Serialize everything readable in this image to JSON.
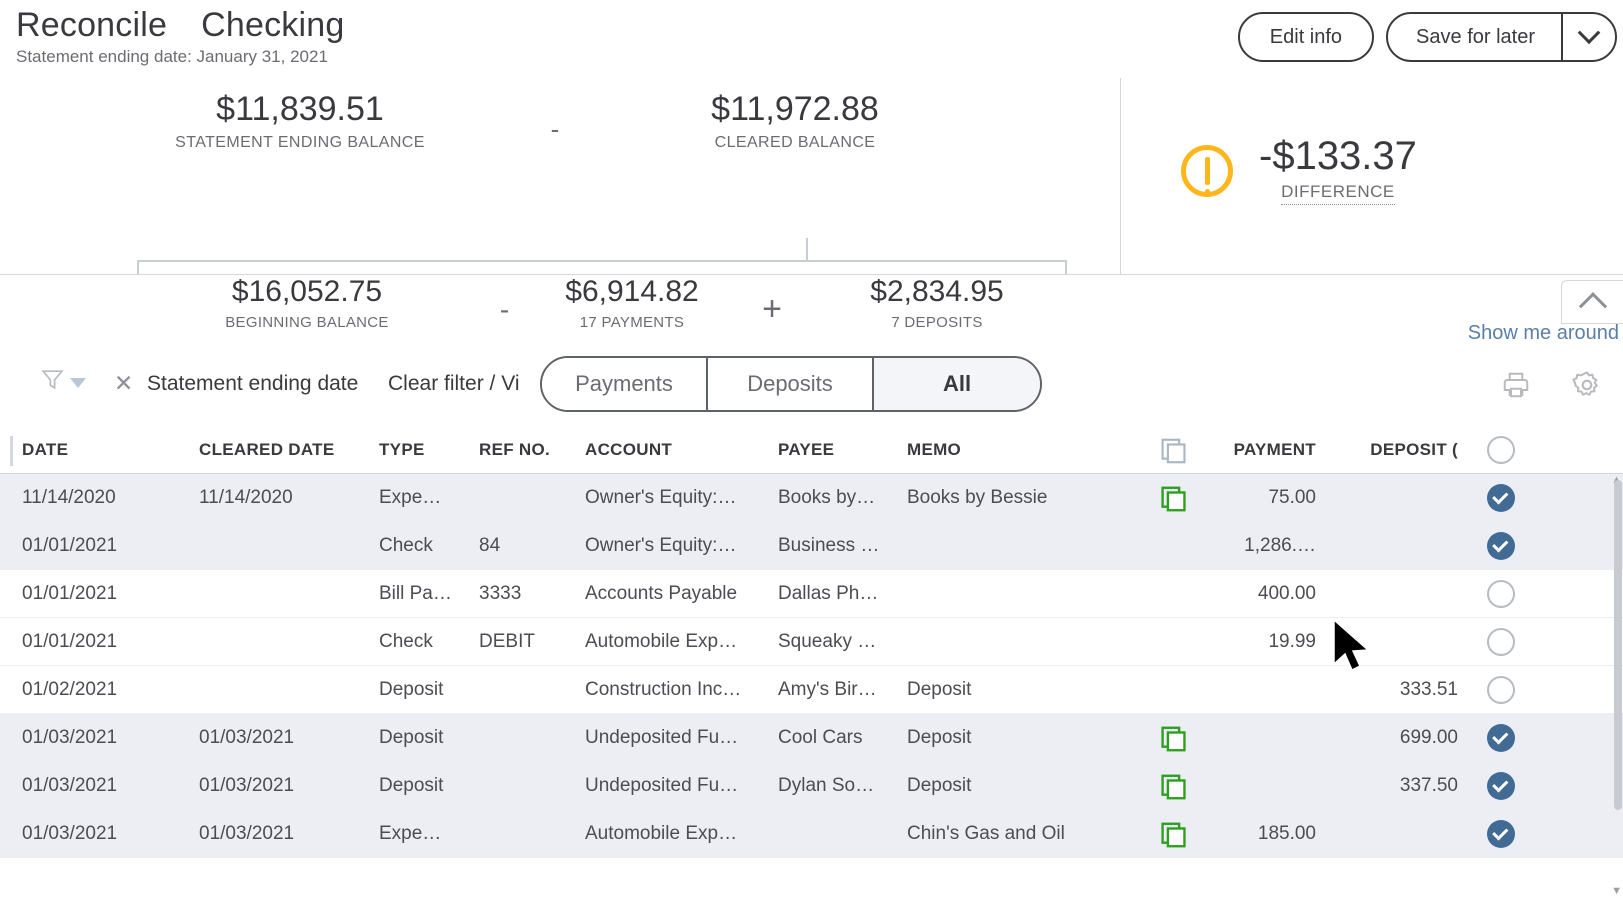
{
  "header": {
    "title": "Reconcile",
    "account": "Checking",
    "subtitle": "Statement ending date: January 31, 2021",
    "edit_info_label": "Edit info",
    "save_for_later_label": "Save for later",
    "caret_icon": "chevron-down-icon"
  },
  "summary": {
    "statement_ending_balance": {
      "value": "$11,839.51",
      "label": "STATEMENT ENDING BALANCE"
    },
    "operator_top": "-",
    "cleared_balance": {
      "value": "$11,972.88",
      "label": "CLEARED BALANCE"
    },
    "beginning_balance": {
      "value": "$16,052.75",
      "label": "BEGINNING BALANCE"
    },
    "operator_minus": "-",
    "payments": {
      "value": "$6,914.82",
      "label": "17 PAYMENTS"
    },
    "operator_plus": "+",
    "deposits": {
      "value": "$2,834.95",
      "label": "7 DEPOSITS"
    },
    "difference": {
      "value": "-$133.37",
      "label": "DIFFERENCE",
      "icon": "warning-icon",
      "icon_color": "#fdb71c"
    }
  },
  "panel": {
    "collapse_icon": "chevron-up-icon",
    "show_me_around": "Show me around"
  },
  "filterbar": {
    "filter_icon": "funnel-icon",
    "remove_chip_icon": "close-icon",
    "chip_label": "Statement ending date",
    "clear_filter_label": "Clear filter / Vi",
    "toggles": [
      {
        "label": "Payments",
        "active": false
      },
      {
        "label": "Deposits",
        "active": false
      },
      {
        "label": "All",
        "active": true
      }
    ],
    "print_icon": "printer-icon",
    "settings_icon": "gear-icon"
  },
  "table": {
    "columns": [
      "DATE",
      "CLEARED DATE",
      "TYPE",
      "REF NO.",
      "ACCOUNT",
      "PAYEE",
      "MEMO",
      "",
      "PAYMENT",
      "DEPOSIT ("
    ],
    "attachment_header_icon": "copy-icon",
    "select_all_icon": "circle-checkbox",
    "rows": [
      {
        "date": "11/14/2020",
        "cleared_date": "11/14/2020",
        "type": "Expe…",
        "ref": "",
        "account": "Owner's Equity:…",
        "payee": "Books by…",
        "memo": "Books by Bessie",
        "dup": true,
        "payment": "75.00",
        "deposit": "",
        "checked": true,
        "shaded": true
      },
      {
        "date": "01/01/2021",
        "cleared_date": "",
        "type": "Check",
        "ref": "84",
        "account": "Owner's Equity:…",
        "payee": "Business …",
        "memo": "",
        "dup": false,
        "payment": "1,286.…",
        "deposit": "",
        "checked": true,
        "shaded": true
      },
      {
        "date": "01/01/2021",
        "cleared_date": "",
        "type": "Bill Pa…",
        "ref": "3333",
        "account": "Accounts Payable",
        "payee": "Dallas Ph…",
        "memo": "",
        "dup": false,
        "payment": "400.00",
        "deposit": "",
        "checked": false,
        "shaded": false
      },
      {
        "date": "01/01/2021",
        "cleared_date": "",
        "type": "Check",
        "ref": "DEBIT",
        "account": "Automobile Exp…",
        "payee": "Squeaky …",
        "memo": "",
        "dup": false,
        "payment": "19.99",
        "deposit": "",
        "checked": false,
        "shaded": false
      },
      {
        "date": "01/02/2021",
        "cleared_date": "",
        "type": "Deposit",
        "ref": "",
        "account": "Construction Inc…",
        "payee": "Amy's Bir…",
        "memo": "Deposit",
        "dup": false,
        "payment": "",
        "deposit": "333.51",
        "checked": false,
        "shaded": false
      },
      {
        "date": "01/03/2021",
        "cleared_date": "01/03/2021",
        "type": "Deposit",
        "ref": "",
        "account": "Undeposited Fu…",
        "payee": "Cool Cars",
        "memo": "Deposit",
        "dup": true,
        "payment": "",
        "deposit": "699.00",
        "checked": true,
        "shaded": true
      },
      {
        "date": "01/03/2021",
        "cleared_date": "01/03/2021",
        "type": "Deposit",
        "ref": "",
        "account": "Undeposited Fu…",
        "payee": "Dylan So…",
        "memo": "Deposit",
        "dup": true,
        "payment": "",
        "deposit": "337.50",
        "checked": true,
        "shaded": true
      },
      {
        "date": "01/03/2021",
        "cleared_date": "01/03/2021",
        "type": "Expe…",
        "ref": "",
        "account": "Automobile Exp…",
        "payee": "",
        "memo": "Chin's Gas and Oil",
        "dup": true,
        "payment": "185.00",
        "deposit": "",
        "checked": true,
        "shaded": true
      }
    ]
  },
  "colors": {
    "accent_blue": "#416a94",
    "warning_yellow": "#fdb71c",
    "link_blue": "#5a7fa8",
    "green_icon": "#2ca01c",
    "row_shade": "#eceef3"
  }
}
